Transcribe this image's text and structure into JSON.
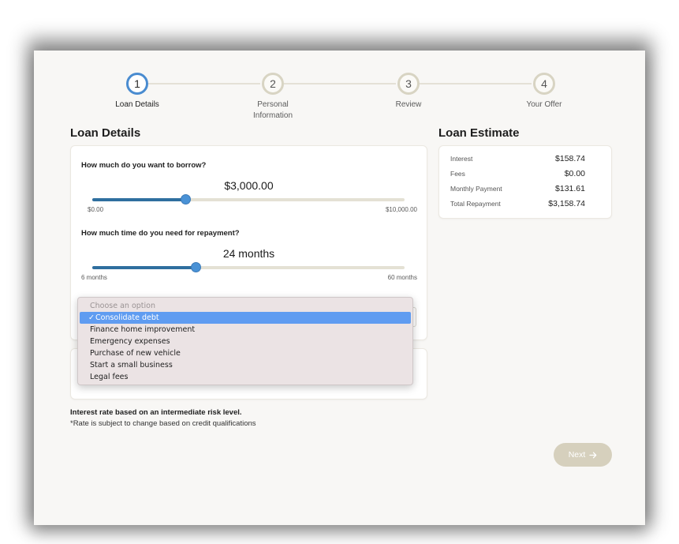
{
  "stepper": {
    "steps": [
      {
        "number": "1",
        "label": "Loan Details",
        "active": true
      },
      {
        "number": "2",
        "label_line1": "Personal",
        "label_line2": "Information",
        "active": false
      },
      {
        "number": "3",
        "label": "Review",
        "active": false
      },
      {
        "number": "4",
        "label": "Your Offer",
        "active": false
      }
    ]
  },
  "loan_details": {
    "title": "Loan Details",
    "amount_question": "How much do you want to borrow?",
    "amount_value": "$3,000.00",
    "amount_min": "$0.00",
    "amount_max": "$10,000.00",
    "amount_fraction": 0.3,
    "term_question": "How much time do you need for repayment?",
    "term_value": "24 months",
    "term_min": "6 months",
    "term_max": "60 months",
    "term_fraction": 0.333
  },
  "purpose_dropdown": {
    "placeholder": "Choose an option",
    "selected_mark": "✓",
    "options": [
      "Consolidate debt",
      "Finance home improvement",
      "Emergency expenses",
      "Purchase of new vehicle",
      "Start a small business",
      "Legal fees"
    ],
    "selected": "Consolidate debt"
  },
  "estimate": {
    "title": "Loan Estimate",
    "rows": [
      {
        "label": "Interest",
        "value": "$158.74"
      },
      {
        "label": "Fees",
        "value": "$0.00"
      },
      {
        "label": "Monthly Payment",
        "value": "$131.61"
      },
      {
        "label": "Total Repayment",
        "value": "$3,158.74"
      }
    ]
  },
  "notes": {
    "rate_basis": "Interest rate based on an intermediate risk level.",
    "disclaimer": "*Rate is subject to change based on credit qualifications"
  },
  "next_button": {
    "label": "Next",
    "icon": "arrow-right-icon"
  },
  "colors": {
    "accent": "#4a92d6",
    "track_fill": "#2f6f9f",
    "next_button": "#d6d0bd",
    "dropdown_highlight": "#5f9cf1"
  }
}
